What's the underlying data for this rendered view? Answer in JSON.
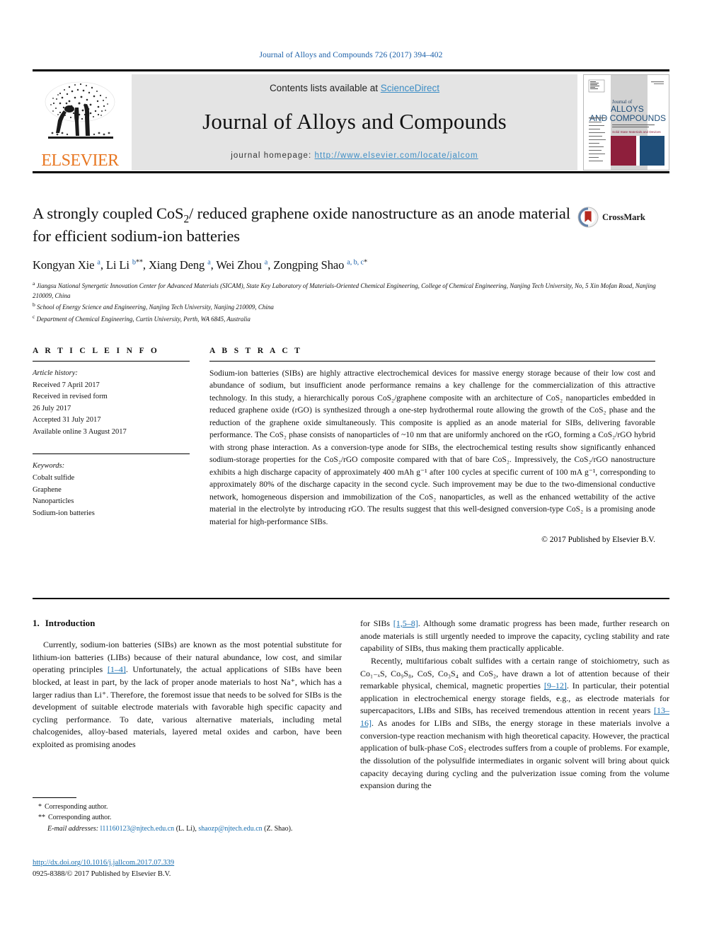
{
  "running_head": "Journal of Alloys and Compounds 726 (2017) 394–402",
  "masthead": {
    "contents_prefix": "Contents lists available at ",
    "sciencedirect": "ScienceDirect",
    "journal_name": "Journal of Alloys and Compounds",
    "homepage_prefix": "journal homepage: ",
    "homepage_url": "http://www.elsevier.com/locate/jalcom",
    "publisher_wordmark": "ELSEVIER",
    "cover_title_line1": "Journal of",
    "cover_title_line2": "ALLOYS",
    "cover_title_line3": "AND COMPOUNDS"
  },
  "article": {
    "title_part1": "A strongly coupled CoS",
    "title_sub1": "2",
    "title_part2": "/ reduced graphene oxide nanostructure as an anode material for efficient sodium-ion batteries",
    "crossmark_label": "CrossMark",
    "authors": [
      {
        "name": "Kongyan Xie",
        "sup": "a",
        "star": ""
      },
      {
        "name": "Li Li",
        "sup": "b",
        "star": "**"
      },
      {
        "name": "Xiang Deng",
        "sup": "a",
        "star": ""
      },
      {
        "name": "Wei Zhou",
        "sup": "a",
        "star": ""
      },
      {
        "name": "Zongping Shao",
        "sup": "a, b, c",
        "star": "*"
      }
    ],
    "affiliations": [
      {
        "mark": "a",
        "text": "Jiangsu National Synergetic Innovation Center for Advanced Materials (SICAM), State Key Laboratory of Materials-Oriented Chemical Engineering, College of Chemical Engineering, Nanjing Tech University, No, 5 Xin Mofan Road, Nanjing 210009, China"
      },
      {
        "mark": "b",
        "text": "School of Energy Science and Engineering, Nanjing Tech University, Nanjing 210009, China"
      },
      {
        "mark": "c",
        "text": "Department of Chemical Engineering, Curtin University, Perth, WA 6845, Australia"
      }
    ]
  },
  "article_info": {
    "heading": "A R T I C L E  I N F O",
    "history_label": "Article history:",
    "history": [
      "Received 7 April 2017",
      "Received in revised form",
      "26 July 2017",
      "Accepted 31 July 2017",
      "Available online 3 August 2017"
    ],
    "keywords_label": "Keywords:",
    "keywords": [
      "Cobalt sulfide",
      "Graphene",
      "Nanoparticles",
      "Sodium-ion batteries"
    ]
  },
  "abstract": {
    "heading": "A B S T R A C T",
    "text": "Sodium-ion batteries (SIBs) are highly attractive electrochemical devices for massive energy storage because of their low cost and abundance of sodium, but insufficient anode performance remains a key challenge for the commercialization of this attractive technology. In this study, a hierarchically porous CoS₂/graphene composite with an architecture of CoS₂ nanoparticles embedded in reduced graphene oxide (rGO) is synthesized through a one-step hydrothermal route allowing the growth of the CoS₂ phase and the reduction of the graphene oxide simultaneously. This composite is applied as an anode material for SIBs, delivering favorable performance. The CoS₂ phase consists of nanoparticles of ~10 nm that are uniformly anchored on the rGO, forming a CoS₂/rGO hybrid with strong phase interaction. As a conversion-type anode for SIBs, the electrochemical testing results show significantly enhanced sodium-storage properties for the CoS₂/rGO composite compared with that of bare CoS₂. Impressively, the CoS₂/rGO nanostructure exhibits a high discharge capacity of approximately 400 mAh g⁻¹ after 100 cycles at specific current of 100 mA g⁻¹, corresponding to approximately 80% of the discharge capacity in the second cycle. Such improvement may be due to the two-dimensional conductive network, homogeneous dispersion and immobilization of the CoS₂ nanoparticles, as well as the enhanced wettability of the active material in the electrolyte by introducing rGO. The results suggest that this well-designed conversion-type CoS₂ is a promising anode material for high-performance SIBs.",
    "copyright": "© 2017 Published by Elsevier B.V."
  },
  "introduction": {
    "number": "1.",
    "heading": "Introduction",
    "left_para_1_a": "Currently, sodium-ion batteries (SIBs) are known as the most potential substitute for lithium-ion batteries (LIBs) because of their natural abundance, low cost, and similar operating principles ",
    "left_ref_1": "[1–4]",
    "left_para_1_b": ". Unfortunately, the actual applications of SIBs have been blocked, at least in part, by the lack of proper anode materials to host Na⁺, which has a larger radius than Li⁺. Therefore, the foremost issue that needs to be solved for SIBs is the development of suitable electrode materials with favorable high specific capacity and cycling performance. To date, various alternative materials, including metal chalcogenides, alloy-based materials, layered metal oxides and carbon, have been exploited as promising anodes",
    "right_para_1_a": "for SIBs ",
    "right_ref_1": "[1,5–8]",
    "right_para_1_b": ". Although some dramatic progress has been made, further research on anode materials is still urgently needed to improve the capacity, cycling stability and rate capability of SIBs, thus making them practically applicable.",
    "right_para_2_a": "Recently, multifarious cobalt sulfides with a certain range of stoichiometry, such as Co₁₋ₓS, Co₉S₈, CoS, Co₃S₄ and CoS₂, have drawn a lot of attention because of their remarkable physical, chemical, magnetic properties ",
    "right_ref_2": "[9–12]",
    "right_para_2_b": ". In particular, their potential application in electrochemical energy storage fields, e.g., as electrode materials for supercapacitors, LIBs and SIBs, has received tremendous attention in recent years ",
    "right_ref_3": "[13–16]",
    "right_para_2_c": ". As anodes for LIBs and SIBs, the energy storage in these materials involve a conversion-type reaction mechanism with high theoretical capacity. However, the practical application of bulk-phase CoS₂ electrodes suffers from a couple of problems. For example, the dissolution of the polysulfide intermediates in organic solvent will bring about quick capacity decaying during cycling and the pulverization issue coming from the volume expansion during the"
  },
  "footnotes": {
    "corr_1_mark": "*",
    "corr_1_text": "Corresponding author.",
    "corr_2_mark": "**",
    "corr_2_text": "Corresponding author.",
    "email_label": "E-mail addresses:",
    "email_1": "l11160123@njtech.edu.cn",
    "email_1_owner": "(L. Li)",
    "email_2": "shaozp@njtech.edu.cn",
    "email_2_owner": "(Z. Shao)."
  },
  "doi": {
    "url": "http://dx.doi.org/10.1016/j.jallcom.2017.07.339",
    "issn_line": "0925-8388/© 2017 Published by Elsevier B.V."
  },
  "colors": {
    "link": "#1a6faf",
    "runhead": "#1a5fa8",
    "sciencedirect": "#3c8dc5",
    "elsevier_orange": "#e87722",
    "band_grey": "#e4e4e4",
    "cover_maroon": "#8e1f3c",
    "cover_blue": "#1f4e79"
  }
}
